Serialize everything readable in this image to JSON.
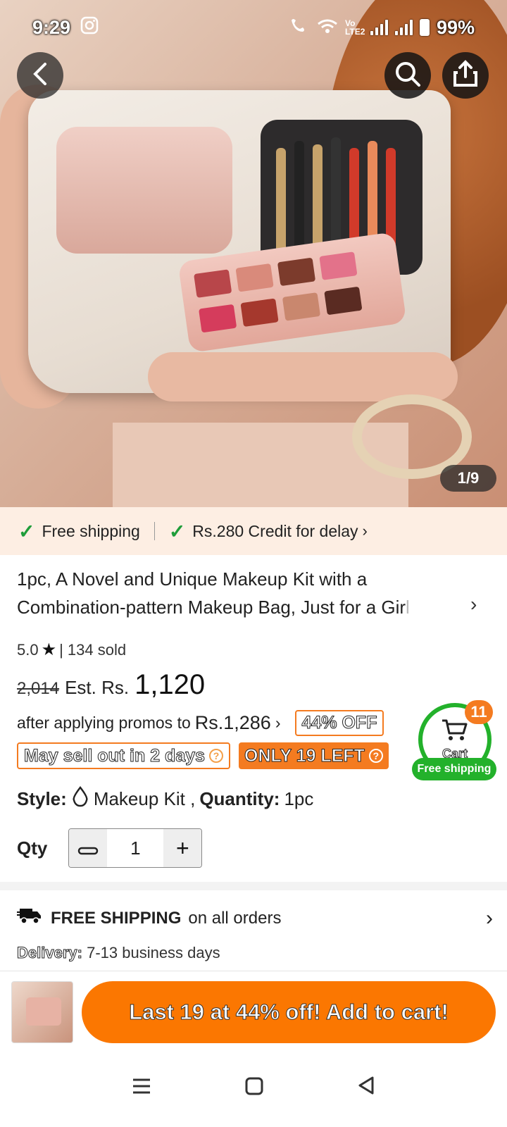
{
  "status_bar": {
    "time": "9:29",
    "network": "Vo LTE2",
    "battery": "99%"
  },
  "gallery": {
    "counter": "1/9"
  },
  "shipping_strip": {
    "free_shipping": "Free shipping",
    "credit": "Rs.280 Credit for delay"
  },
  "product": {
    "title_line1": "1pc, A Novel and Unique Makeup Kit with a",
    "title_line2": "Combination-pattern Makeup Bag, Just for a Gir",
    "title_fade": "l",
    "rating": "5.0",
    "sold": "| 134 sold",
    "old_price": "2,014",
    "est_label": "Est. Rs.",
    "price": "1,120",
    "promo_text": "after applying promos to",
    "promo_price": "Rs.1,286",
    "discount_badge": "44% OFF",
    "sell_out_badge": "May sell out in 2 days",
    "stock_badge": "ONLY 19 LEFT",
    "style_label": "Style:",
    "style_value": "Makeup Kit ,",
    "quantity_label": "Quantity:",
    "quantity_value": "1pc",
    "qty_label": "Qty",
    "qty_value": "1"
  },
  "cart": {
    "count": "11",
    "label": "Cart",
    "free_shipping": "Free shipping"
  },
  "shipping_info": {
    "headline": "FREE SHIPPING",
    "rest": "on all orders",
    "delivery_label": "Delivery:",
    "delivery_value": "7-13 business days"
  },
  "bottom_bar": {
    "add_to_cart": "Last 19 at 44% off! Add to cart!"
  },
  "colors": {
    "accent": "#fb7701",
    "green": "#23b12b",
    "strip_bg": "#fdeee3"
  }
}
